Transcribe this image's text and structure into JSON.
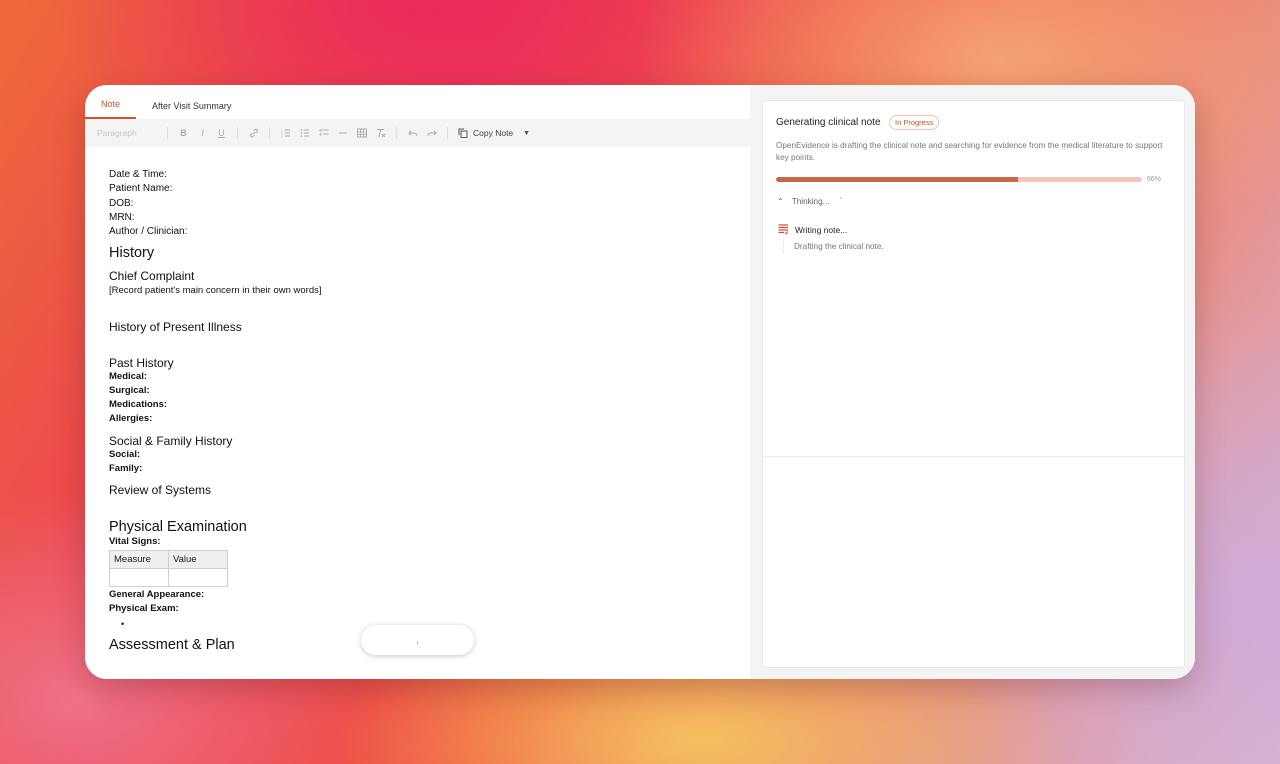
{
  "tabs": [
    {
      "label": "Note",
      "active": true
    },
    {
      "label": "After Visit Summary",
      "active": false
    }
  ],
  "toolbar": {
    "paragraph_label": "Paragraph",
    "icons": [
      "bold-icon",
      "italic-icon",
      "underline-icon",
      "link-icon",
      "ordered-list-icon",
      "bullet-list-icon",
      "checklist-icon",
      "horizontal-rule-icon",
      "table-icon",
      "clear-format-icon",
      "undo-icon",
      "redo-icon"
    ],
    "copy_label": "Copy Note"
  },
  "note": {
    "meta": [
      "Date & Time:",
      "Patient Name:",
      "DOB:",
      "MRN:",
      "Author / Clinician:"
    ],
    "history_heading": "History",
    "chief_complaint_heading": "Chief Complaint",
    "chief_complaint_text": "[Record patient's main concern in their own words]",
    "hpi_heading": "History of Present Illness",
    "past_history_heading": "Past History",
    "past_history_items": [
      "Medical:",
      "Surgical:",
      "Medications:",
      "Allergies:"
    ],
    "social_family_heading": "Social & Family History",
    "social_family_items": [
      "Social:",
      "Family:"
    ],
    "ros_heading": "Review of Systems",
    "physical_exam_heading": "Physical Examination",
    "vital_signs_label": "Vital Signs:",
    "vitals_table": {
      "headers": [
        "Measure",
        "Value"
      ]
    },
    "general_appearance_label": "General Appearance:",
    "physical_exam_label": "Physical Exam:",
    "assessment_heading": "Assessment & Plan"
  },
  "floating_pill": {
    "text": ","
  },
  "side": {
    "title": "Generating clinical note",
    "status": "In Progress",
    "description": "OpenEvidence is drafting the clinical note and searching for evidence from the medical literature to support key points.",
    "progress": 0.66,
    "progress_label": "66%",
    "thinking_label": "Thinking...",
    "thinking_mark": "`",
    "step_title": "Writing note...",
    "step_desc": "Drafting the clinical note.",
    "accent_color": "#c9542e"
  }
}
